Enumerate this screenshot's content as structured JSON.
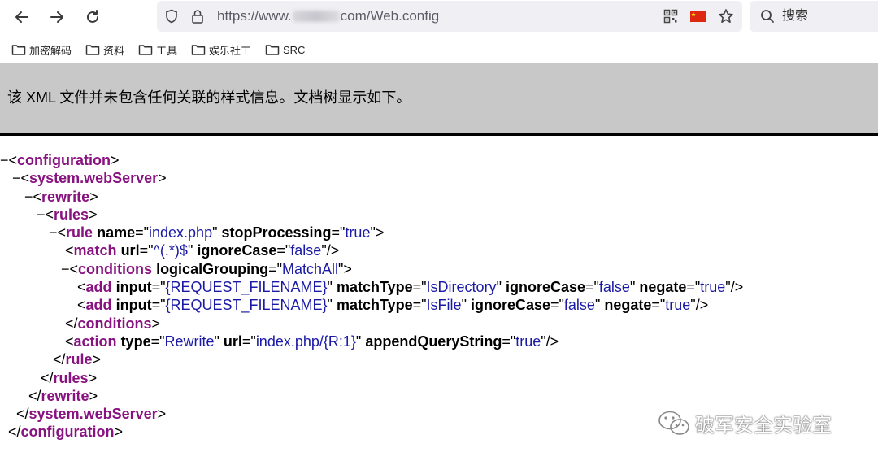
{
  "browser": {
    "url_prefix": "https://www.",
    "url_suffix": "com/Web.config",
    "search_placeholder": "搜索",
    "icons": [
      "back-icon",
      "forward-icon",
      "reload-icon",
      "shield-icon",
      "lock-icon",
      "qr-code-icon",
      "china-flag-icon",
      "bookmark-star-icon",
      "search-icon"
    ]
  },
  "bookmarks": [
    {
      "label": "加密解码"
    },
    {
      "label": "资料"
    },
    {
      "label": "工具"
    },
    {
      "label": "娱乐社工"
    },
    {
      "label": "SRC"
    }
  ],
  "info_message": "该 XML 文件并未包含任何关联的样式信息。文档树显示如下。",
  "xml_tree": {
    "configuration": "configuration",
    "system_webserver": "system.webServer",
    "rewrite": "rewrite",
    "rules": "rules",
    "rule": {
      "tag": "rule",
      "name_attr": "name",
      "name_val": "index.php",
      "stop_attr": "stopProcessing",
      "stop_val": "true"
    },
    "match": {
      "tag": "match",
      "url_attr": "url",
      "url_val": "^(.*)$",
      "ic_attr": "ignoreCase",
      "ic_val": "false"
    },
    "conditions": {
      "tag": "conditions",
      "lg_attr": "logicalGrouping",
      "lg_val": "MatchAll"
    },
    "add1": {
      "tag": "add",
      "input_attr": "input",
      "input_val": "{REQUEST_FILENAME}",
      "mt_attr": "matchType",
      "mt_val": "IsDirectory",
      "ic_attr": "ignoreCase",
      "ic_val": "false",
      "neg_attr": "negate",
      "neg_val": "true"
    },
    "add2": {
      "tag": "add",
      "input_attr": "input",
      "input_val": "{REQUEST_FILENAME}",
      "mt_attr": "matchType",
      "mt_val": "IsFile",
      "ic_attr": "ignoreCase",
      "ic_val": "false",
      "neg_attr": "negate",
      "neg_val": "true"
    },
    "action": {
      "tag": "action",
      "type_attr": "type",
      "type_val": "Rewrite",
      "url_attr": "url",
      "url_val": "index.php/{R:1}",
      "aqs_attr": "appendQueryString",
      "aqs_val": "true"
    }
  },
  "watermark": "破军安全实验室",
  "colors": {
    "tag": "#881280",
    "value": "#1a1aa6",
    "infobar": "#c8c8c8",
    "urlbar": "#f0f0f4"
  }
}
